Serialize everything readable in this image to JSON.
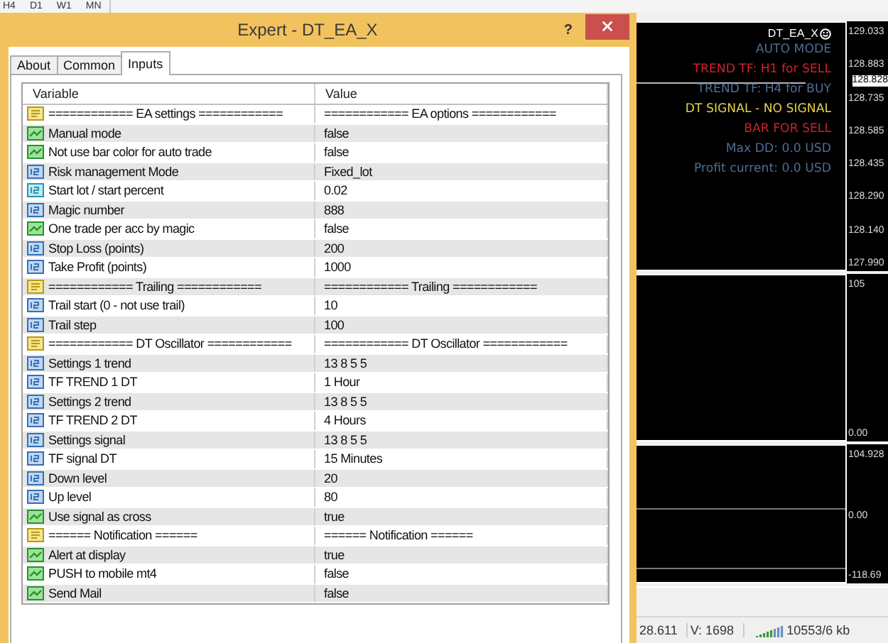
{
  "timeframes": [
    {
      "label": "H4"
    },
    {
      "label": "D1"
    },
    {
      "label": "W1"
    },
    {
      "label": "MN"
    }
  ],
  "dialog": {
    "title": "Expert - DT_EA_X",
    "help": "?",
    "tabs": [
      {
        "label": "About",
        "selected": false
      },
      {
        "label": "Common",
        "selected": false
      },
      {
        "label": "Inputs",
        "selected": true
      }
    ],
    "columns": [
      "Variable",
      "Value"
    ],
    "rows": [
      {
        "kind": "string",
        "variable": "============ EA settings ============",
        "value": "============ EA options ============"
      },
      {
        "kind": "bool",
        "variable": "Manual mode",
        "value": "false"
      },
      {
        "kind": "bool",
        "variable": "Not use bar color for auto trade",
        "value": "false"
      },
      {
        "kind": "int",
        "variable": "Risk management Mode",
        "value": "Fixed_lot"
      },
      {
        "kind": "double",
        "variable": "Start lot / start percent",
        "value": "0.02"
      },
      {
        "kind": "int",
        "variable": "Magic number",
        "value": "888"
      },
      {
        "kind": "bool",
        "variable": "One trade per acc by magic",
        "value": "false"
      },
      {
        "kind": "int",
        "variable": "Stop Loss (points)",
        "value": "200"
      },
      {
        "kind": "int",
        "variable": "Take Profit (points)",
        "value": "1000"
      },
      {
        "kind": "string",
        "variable": "============ Trailing ============",
        "value": "============ Trailing ============"
      },
      {
        "kind": "int",
        "variable": "Trail start (0 - not use trail)",
        "value": "10"
      },
      {
        "kind": "int",
        "variable": "Trail step",
        "value": "100"
      },
      {
        "kind": "string",
        "variable": "============ DT Oscillator ============",
        "value": "============ DT Oscillator ============"
      },
      {
        "kind": "int",
        "variable": "Settings 1 trend",
        "value": "13 8 5 5"
      },
      {
        "kind": "int",
        "variable": "TF TREND 1 DT",
        "value": "1 Hour"
      },
      {
        "kind": "int",
        "variable": "Settings 2 trend",
        "value": "13 8 5 5"
      },
      {
        "kind": "int",
        "variable": "TF TREND 2 DT",
        "value": "4 Hours"
      },
      {
        "kind": "int",
        "variable": "Settings signal",
        "value": "13 8 5 5"
      },
      {
        "kind": "int",
        "variable": "TF signal DT",
        "value": "15 Minutes"
      },
      {
        "kind": "int",
        "variable": "Down level",
        "value": "20"
      },
      {
        "kind": "int",
        "variable": "Up level",
        "value": "80"
      },
      {
        "kind": "bool",
        "variable": "Use signal as cross",
        "value": "true"
      },
      {
        "kind": "string",
        "variable": "====== Notification ======",
        "value": "====== Notification ======"
      },
      {
        "kind": "bool",
        "variable": "Alert at display",
        "value": "true"
      },
      {
        "kind": "bool",
        "variable": "PUSH to mobile mt4",
        "value": "false"
      },
      {
        "kind": "bool",
        "variable": "Send Mail",
        "value": "false"
      }
    ]
  },
  "chart": {
    "expert_label": "DT_EA_X",
    "info_lines": [
      {
        "text": "AUTO MODE",
        "color": "#4f6d95"
      },
      {
        "text": "TREND TF: H1 for SELL",
        "color": "#d21f2b"
      },
      {
        "text": "TREND TF: H4 for BUY",
        "color": "#4f6d95"
      },
      {
        "text": "DT SIGNAL - NO SIGNAL",
        "color": "#e3d24a"
      },
      {
        "text": "BAR FOR SELL",
        "color": "#d21f2b"
      },
      {
        "text": "Max DD: 0.0 USD",
        "color": "#4f6d95"
      },
      {
        "text": "Profit current: 0.0 USD",
        "color": "#4f6d95"
      }
    ],
    "price_scale": [
      "129.033",
      "128.883",
      "128.735",
      "128.585",
      "128.435",
      "128.290",
      "128.140",
      "127.990"
    ],
    "current_price": "128.828",
    "indicator_1_scale": [
      "105",
      "0.00"
    ],
    "indicator_2_scale": [
      "104.928",
      "0.00",
      "-118.69"
    ]
  },
  "status_bar": [
    "28.611",
    "V: 1698",
    "10553/6 kb"
  ]
}
